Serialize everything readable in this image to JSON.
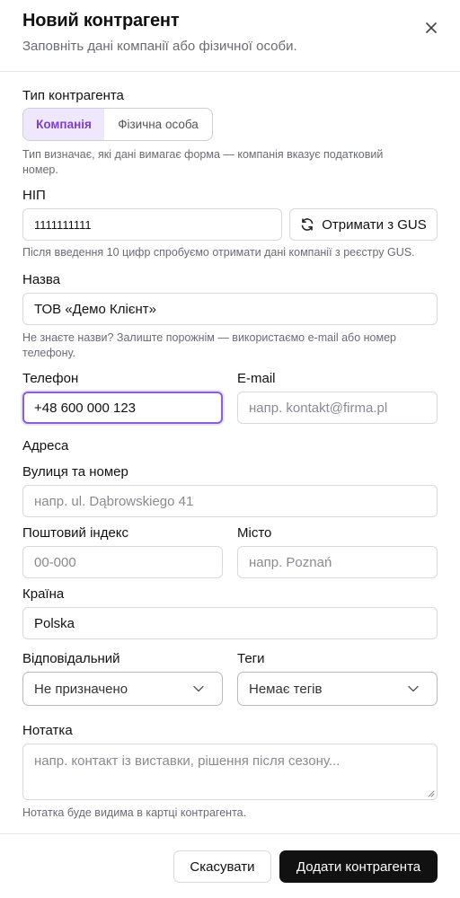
{
  "dialog": {
    "title": "Новий контрагент",
    "subtitle": "Заповніть дані компанії або фізичної особи.",
    "close_icon": "close-icon"
  },
  "type": {
    "label": "Тип контрагента",
    "options": [
      "Компанія",
      "Фізична особа"
    ],
    "selected": "Компанія",
    "hint_line1": "Тип визначає, які дані вимагає форма — компанія вказує податковий",
    "hint_line2": "номер."
  },
  "nip": {
    "label": "НІП",
    "value": "1111111111",
    "gus_button": "Отримати з GUS",
    "gus_icon": "refresh-icon",
    "hint": "Після введення 10 цифр спробуємо отримати дані компанії з реєстру GUS."
  },
  "name": {
    "label": "Назва",
    "value": "ТОВ «Демо Клієнт»",
    "hint_line1": "Не знаєте назви? Залиште порожнім — використаємо e-mail або номер",
    "hint_line2": "телефону."
  },
  "phone": {
    "label": "Телефон",
    "value": "+48 600 000 123"
  },
  "email": {
    "label": "E-mail",
    "placeholder": "напр. kontakt@firma.pl"
  },
  "address": {
    "section_label": "Адреса",
    "street_label": "Вулиця та номер",
    "street_placeholder": "напр. ul. Dąbrowskiego 41",
    "postal_label": "Поштовий індекс",
    "postal_placeholder": "00-000",
    "city_label": "Місто",
    "city_placeholder": "напр. Poznań",
    "country_label": "Країна",
    "country_value": "Polska"
  },
  "owner": {
    "label": "Відповідальний",
    "selected": "Не призначено"
  },
  "tags": {
    "label": "Теги",
    "selected": "Немає тегів"
  },
  "note": {
    "label": "Нотатка",
    "placeholder": "напр. контакт із виставки, рішення після сезону...",
    "hint": "Нотатка буде видима в картці контрагента."
  },
  "footer": {
    "cancel_label": "Скасувати",
    "submit_label": "Додати контрагента"
  },
  "colors": {
    "accent": "#8b5fd6",
    "segment_active_bg": "#efe7fb",
    "segment_active_text": "#7c3fd0",
    "primary_button": "#111111"
  }
}
